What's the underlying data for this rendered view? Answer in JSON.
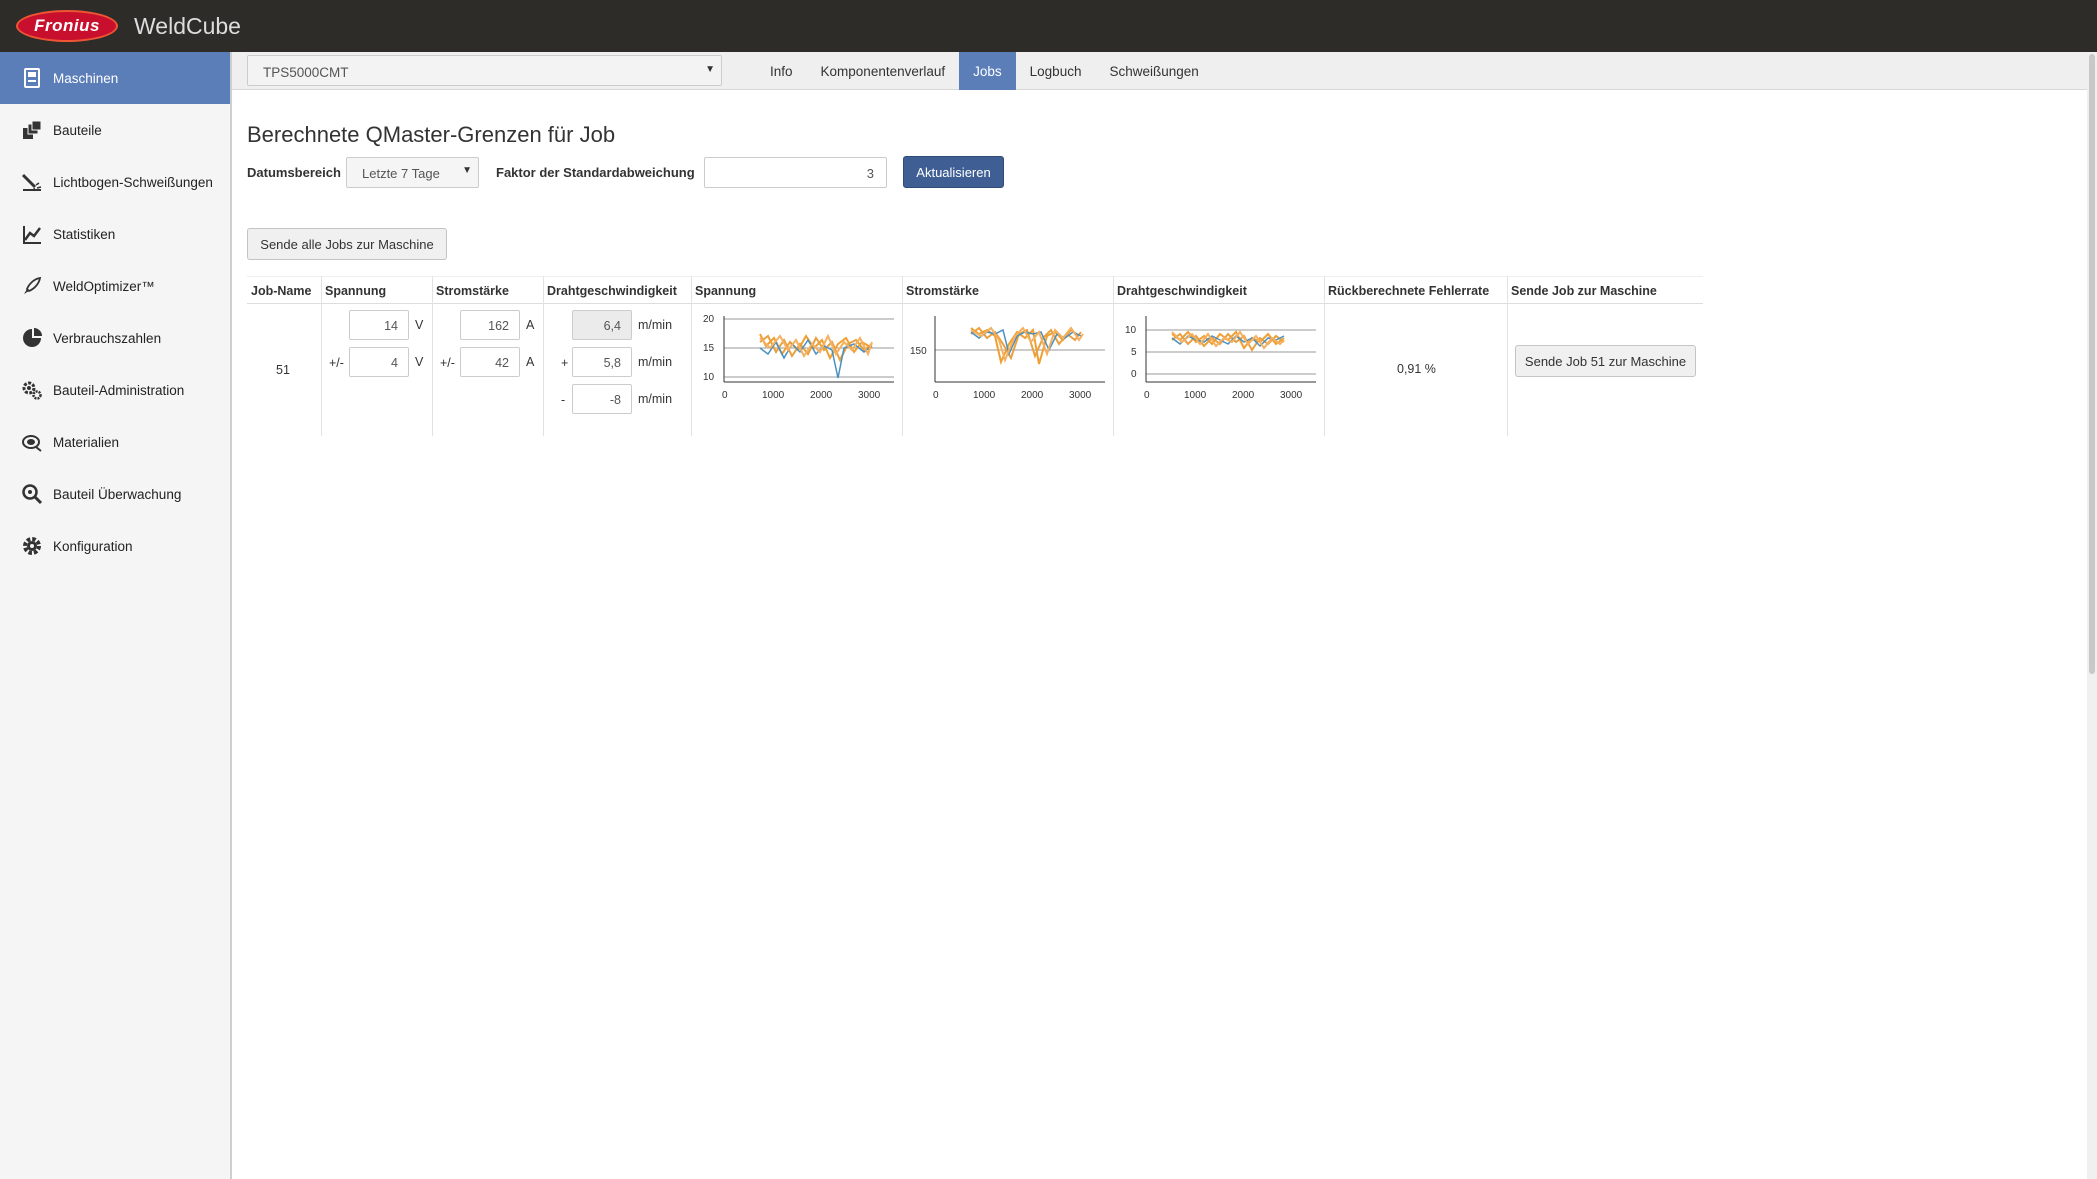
{
  "header": {
    "logo_text": "Fronius",
    "app_title": "WeldCube"
  },
  "sidebar": {
    "items": [
      {
        "label": "Maschinen",
        "icon": "machine-icon",
        "active": true
      },
      {
        "label": "Bauteile",
        "icon": "parts-icon"
      },
      {
        "label": "Lichtbogen-Schweißungen",
        "icon": "arc-welding-icon"
      },
      {
        "label": "Statistiken",
        "icon": "statistics-icon"
      },
      {
        "label": "WeldOptimizer™",
        "icon": "rocket-icon"
      },
      {
        "label": "Verbrauchszahlen",
        "icon": "pie-chart-icon"
      },
      {
        "label": "Bauteil-Administration",
        "icon": "gears-icon"
      },
      {
        "label": "Materialien",
        "icon": "materials-icon"
      },
      {
        "label": "Bauteil Überwachung",
        "icon": "magnifier-icon"
      },
      {
        "label": "Konfiguration",
        "icon": "gear-icon"
      }
    ]
  },
  "machine_select": {
    "value": "TPS5000CMT"
  },
  "tabs": [
    {
      "label": "Info"
    },
    {
      "label": "Komponentenverlauf"
    },
    {
      "label": "Jobs",
      "active": true
    },
    {
      "label": "Logbuch"
    },
    {
      "label": "Schweißungen"
    }
  ],
  "page": {
    "title": "Berechnete QMaster-Grenzen für Job",
    "date_range_label": "Datumsbereich",
    "date_range_value": "Letzte 7 Tage",
    "factor_label": "Faktor der Standardabweichung",
    "factor_value": "3",
    "refresh_button": "Aktualisieren",
    "send_all_button": "Sende alle Jobs zur Maschine"
  },
  "table": {
    "headers": [
      "Job-Name",
      "Spannung",
      "Stromstärke",
      "Drahtgeschwindigkeit",
      "Spannung",
      "Stromstärke",
      "Drahtgeschwindigkeit",
      "Rückberechnete Fehlerrate",
      "Sende Job zur Maschine"
    ],
    "row": {
      "job_name": "51",
      "spannung_value": "14",
      "spannung_unit": "V",
      "spannung_tol_prefix": "+/-",
      "spannung_tol": "4",
      "spannung_tol_unit": "V",
      "strom_value": "162",
      "strom_unit": "A",
      "strom_tol_prefix": "+/-",
      "strom_tol": "42",
      "strom_tol_unit": "A",
      "draht_value": "6,4",
      "draht_unit": "m/min",
      "draht_plus_prefix": "+",
      "draht_plus": "5,8",
      "draht_plus_unit": "m/min",
      "draht_minus_prefix": "-",
      "draht_minus": "-8",
      "draht_minus_unit": "m/min",
      "fehlerrate": "0,91 %",
      "send_button": "Sende Job 51 zur Maschine"
    }
  },
  "charts": {
    "spannung": {
      "y_ticks": [
        "20",
        "15",
        "10"
      ],
      "x_ticks": [
        "0",
        "1000",
        "2000",
        "3000"
      ]
    },
    "strom": {
      "y_ticks": [
        "150"
      ],
      "x_ticks": [
        "0",
        "1000",
        "2000",
        "3000"
      ]
    },
    "draht": {
      "y_ticks": [
        "10",
        "5",
        "0"
      ],
      "x_ticks": [
        "0",
        "1000",
        "2000",
        "3000"
      ]
    },
    "series_colors": [
      "#f0a030",
      "#e8a040",
      "#4a90c0",
      "#f5b060"
    ]
  }
}
